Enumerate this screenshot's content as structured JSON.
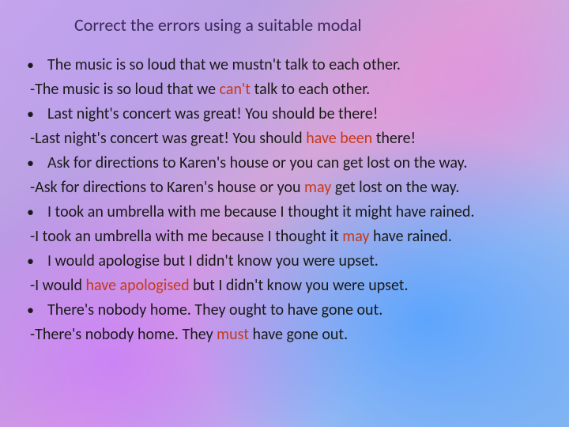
{
  "title": "Correct the errors using a suitable modal",
  "items": [
    {
      "question": "The music is so loud that we mustn't talk to each other.",
      "answer": [
        {
          "t": "The music is so loud that we ",
          "c": false
        },
        {
          "t": "can't",
          "c": true
        },
        {
          "t": " talk to each other.",
          "c": false
        }
      ]
    },
    {
      "question": "Last night's concert was great! You should be there!",
      "answer": [
        {
          "t": "Last night's concert was great! You should ",
          "c": false
        },
        {
          "t": "have been",
          "c": true
        },
        {
          "t": " there!",
          "c": false
        }
      ]
    },
    {
      "question": "Ask for directions to  Karen's house or you can get lost on the way.",
      "answer": [
        {
          "t": "Ask for directions to  Karen's house or you ",
          "c": false
        },
        {
          "t": "may",
          "c": true
        },
        {
          "t": " get lost on the way.",
          "c": false
        }
      ]
    },
    {
      "question": "I took an umbrella with me because I thought it might have rained.",
      "answer": [
        {
          "t": "I took an umbrella with me because I thought it ",
          "c": false
        },
        {
          "t": "may",
          "c": true
        },
        {
          "t": " have rained.",
          "c": false
        }
      ]
    },
    {
      "question": "I would apologise but I didn't know you were upset.",
      "answer": [
        {
          "t": "I would ",
          "c": false
        },
        {
          "t": "have apologised",
          "c": true
        },
        {
          "t": " but I didn't know you were upset.",
          "c": false
        }
      ]
    },
    {
      "question": "There's nobody home. They ought to have gone out.",
      "answer": [
        {
          "t": "There's nobody home. They ",
          "c": false
        },
        {
          "t": "must",
          "c": true
        },
        {
          "t": " have gone out.",
          "c": false
        }
      ]
    }
  ]
}
